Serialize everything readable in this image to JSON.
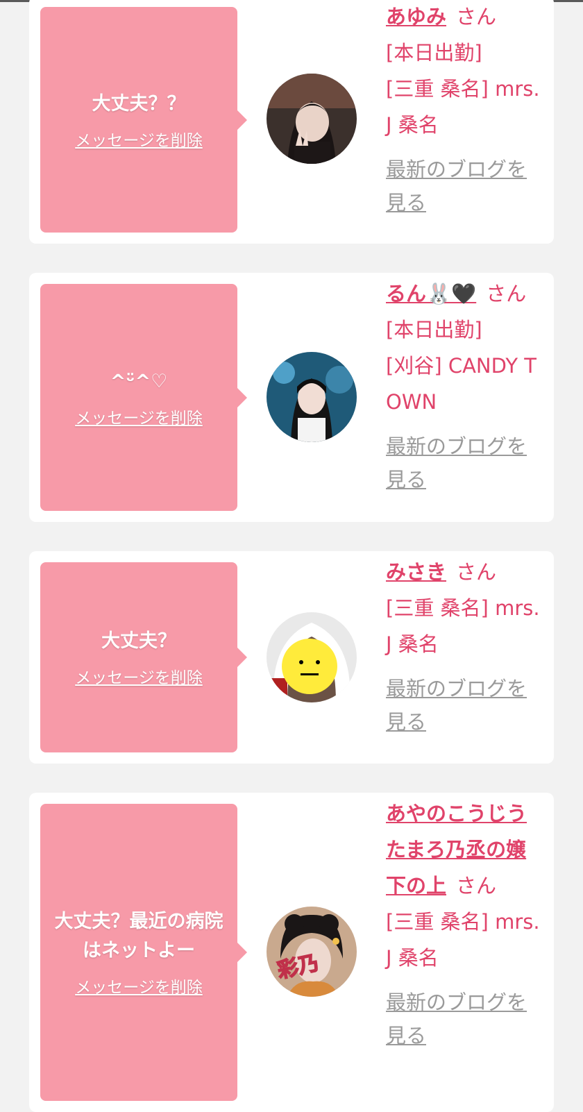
{
  "cards": [
    {
      "message": "大丈夫？？",
      "delete_label": "メッセージを削除",
      "name": "あゆみ",
      "honorific": "さん",
      "status": "[本日出勤]",
      "shop": "[三重 桑名] mrs.J 桑名",
      "blog_label": "最新のブログを見る"
    },
    {
      "message": "^ᵕ̈^♡",
      "delete_label": "メッセージを削除",
      "name": "るん🐰🖤",
      "honorific": "さん",
      "status": "[本日出勤]",
      "shop": "[刈谷] CANDY TOWN",
      "blog_label": "最新のブログを見る"
    },
    {
      "message": "大丈夫？",
      "delete_label": "メッセージを削除",
      "name": "みさき",
      "honorific": "さん",
      "status": "",
      "shop": "[三重 桑名] mrs.J 桑名",
      "blog_label": "最新のブログを見る"
    },
    {
      "message": "大丈夫？最近の病院はネットよー",
      "delete_label": "メッセージを削除",
      "name": "あやのこうじうたまろ乃丞の嬢下の上",
      "honorific": "さん",
      "status": "",
      "shop": "[三重 桑名] mrs.J 桑名",
      "blog_label": "最新のブログを見る",
      "avatar_text": "彩乃"
    }
  ],
  "colors": {
    "bubble": "#f79aa8",
    "accent": "#e0436a",
    "link_gray": "#9a9a9a",
    "background": "#f2f2f2"
  }
}
